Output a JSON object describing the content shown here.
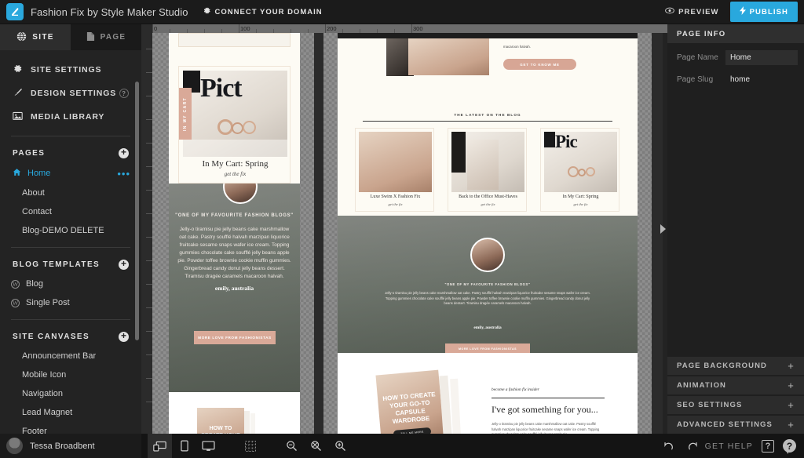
{
  "topbar": {
    "brand_title": "Fashion Fix by Style Maker Studio",
    "connect_domain": "CONNECT YOUR DOMAIN",
    "preview": "PREVIEW",
    "publish": "PUBLISH",
    "accent_color": "#29a8dd"
  },
  "sidebar": {
    "tabs": [
      {
        "label": "SITE",
        "icon": "globe-icon",
        "active": true
      },
      {
        "label": "PAGE",
        "icon": "document-icon",
        "active": false
      }
    ],
    "links": [
      {
        "label": "SITE SETTINGS",
        "icon": "gear-icon",
        "help": ""
      },
      {
        "label": "DESIGN SETTINGS",
        "icon": "brush-icon",
        "help": "?"
      },
      {
        "label": "MEDIA LIBRARY",
        "icon": "image-icon",
        "help": ""
      }
    ],
    "sections": [
      {
        "title": "PAGES",
        "add": "+",
        "items": [
          {
            "label": "Home",
            "icon": "home-icon",
            "active": true,
            "menu": "•••",
            "indent": false
          },
          {
            "label": "About",
            "icon": "",
            "active": false,
            "menu": "",
            "indent": true
          },
          {
            "label": "Contact",
            "icon": "",
            "active": false,
            "menu": "",
            "indent": true
          },
          {
            "label": "Blog-DEMO DELETE",
            "icon": "",
            "active": false,
            "menu": "",
            "indent": true
          }
        ]
      },
      {
        "title": "BLOG TEMPLATES",
        "add": "+",
        "items": [
          {
            "label": "Blog",
            "icon": "wordpress-icon",
            "active": false,
            "menu": "",
            "indent": true
          },
          {
            "label": "Single Post",
            "icon": "wordpress-icon",
            "active": false,
            "menu": "",
            "indent": true
          }
        ]
      },
      {
        "title": "SITE CANVASES",
        "add": "+",
        "items": [
          {
            "label": "Announcement Bar",
            "icon": "",
            "active": false,
            "menu": "",
            "indent": true
          },
          {
            "label": "Mobile Icon",
            "icon": "",
            "active": false,
            "menu": "",
            "indent": true
          },
          {
            "label": "Navigation",
            "icon": "",
            "active": false,
            "menu": "",
            "indent": true
          },
          {
            "label": "Lead Magnet",
            "icon": "",
            "active": false,
            "menu": "",
            "indent": true
          },
          {
            "label": "Footer",
            "icon": "",
            "active": false,
            "menu": "",
            "indent": true
          }
        ]
      }
    ]
  },
  "user": {
    "name": "Tessa Broadbent",
    "avatar": "avatar"
  },
  "bottombar": {
    "devices": [
      {
        "name": "responsive-view",
        "active": true
      },
      {
        "name": "mobile-view",
        "active": false
      },
      {
        "name": "desktop-view",
        "active": false
      }
    ],
    "grid": "grid-toggle",
    "zoom_out": "zoom-out",
    "zoom_reset": "zoom-reset",
    "zoom_in": "zoom-in",
    "undo": "undo",
    "redo": "redo",
    "get_help": "GET HELP",
    "help_doc": "?",
    "help_chat": "?"
  },
  "canvas": {
    "ruler_labels": [
      "0",
      "100",
      "200",
      "300"
    ],
    "collapse_arrow": "chevron-right-icon"
  },
  "site": {
    "hero_tag": "IN MY CART",
    "featured_post": {
      "title": "In My Cart: Spring",
      "subtitle": "get the fix"
    },
    "about_cta": "GET TO KNOW ME",
    "about_tail": "macaroon halvah.",
    "blog_section_title": "THE LATEST ON THE BLOG",
    "blog_posts": [
      {
        "title": "Luxe Swim X Fashion Fix",
        "subtitle": "get the fix"
      },
      {
        "title": "Back to the Office Must-Haves",
        "subtitle": "get the fix"
      },
      {
        "title": "In My Cart: Spring",
        "subtitle": "get the fix"
      }
    ],
    "testimonial": {
      "quote": "\"ONE OF MY FAVOURITE FASHION BLOGS\"",
      "body": "Jelly-o tiramisu pie jelly beans cake marshmallow oat cake. Pastry soufflé halvah marzipan liquorice fruitcake sesame snaps wafer ice cream. Topping gummies chocolate cake soufflé jelly beans apple pie. Powder toffee brownie cookie muffin gummies. Gingerbread candy donut jelly beans dessert. Tiramisu dragée caramels macaroon halvah.",
      "author": "emily, australia",
      "cta": "MORE LOVE FROM FASHIONISTAS"
    },
    "lead_magnet": {
      "eyebrow": "become a fashion fix insider",
      "heading": "I've got something for you...",
      "body": "Jelly-o tiramisu pie jelly beans cake marshmallow oat cake. Pastry soufflé halvah marzipan liquorice fruitcake sesame snaps wafer ice cream. Topping gummies chocolate cake soufflé jelly beans apple pie.",
      "ebook_title": "HOW TO CREATE YOUR GO-TO CAPSULE WARDROBE",
      "ebook_btn": "TELL ME MORE"
    }
  },
  "right_panel": {
    "header": "PAGE INFO",
    "fields": [
      {
        "label": "Page Name",
        "value": "Home",
        "editable": true
      },
      {
        "label": "Page Slug",
        "value": "home",
        "editable": false
      }
    ],
    "accordions": [
      {
        "label": "PAGE BACKGROUND",
        "toggle": "+"
      },
      {
        "label": "ANIMATION",
        "toggle": "+"
      },
      {
        "label": "SEO SETTINGS",
        "toggle": "+"
      },
      {
        "label": "ADVANCED SETTINGS",
        "toggle": "+"
      }
    ]
  }
}
